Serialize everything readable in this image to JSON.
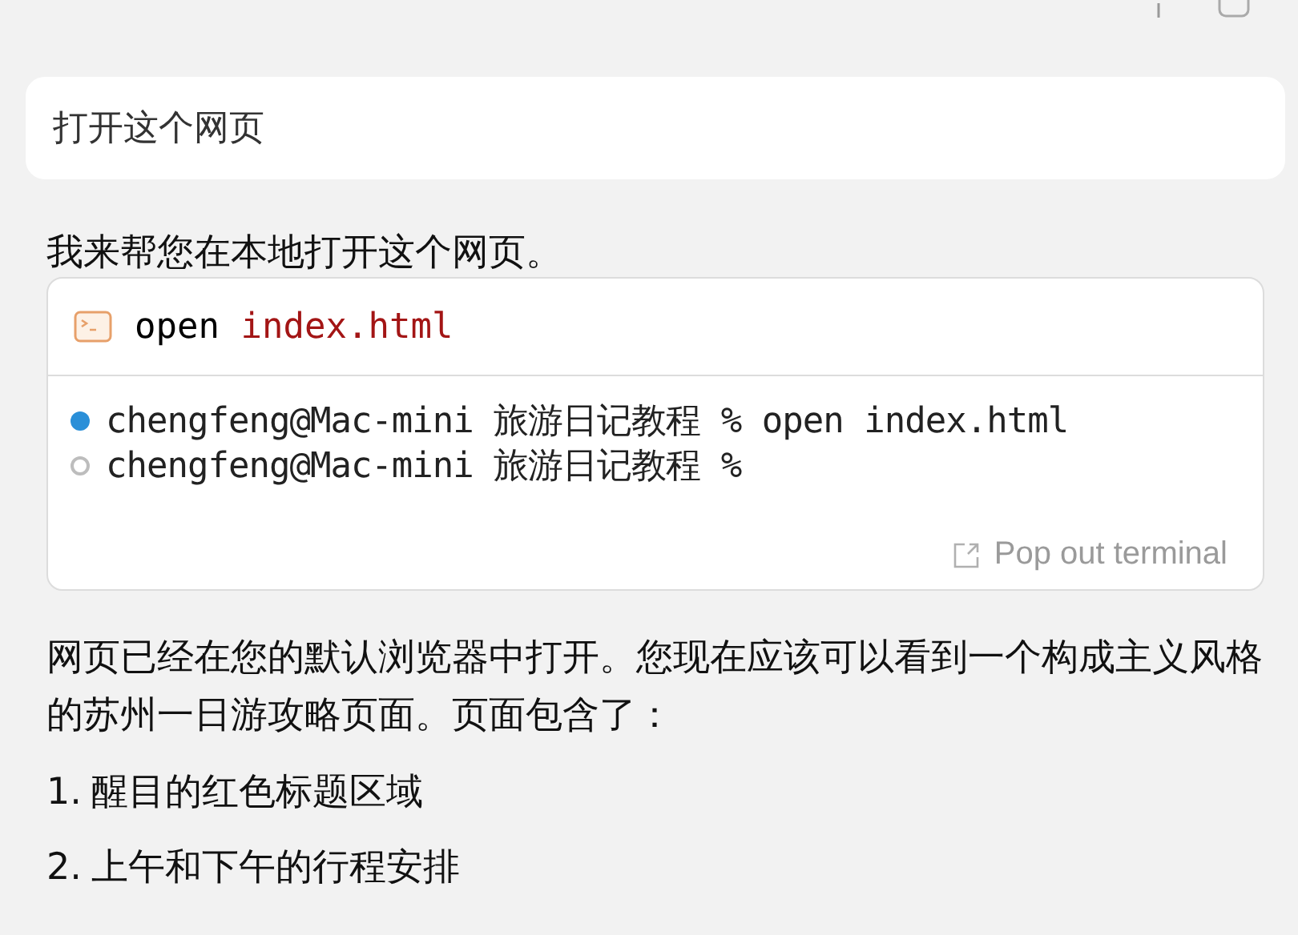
{
  "user_message": {
    "text": "打开这个网页"
  },
  "reply_intro": "我来帮您在本地打开这个网页。",
  "terminal": {
    "command": "open",
    "argument": "index.html",
    "lines": [
      {
        "kind": "active",
        "text": "chengfeng@Mac-mini 旅游日记教程 % open index.html"
      },
      {
        "kind": "idle",
        "text": "chengfeng@Mac-mini 旅游日记教程 %"
      }
    ],
    "pop_out": "Pop out terminal"
  },
  "reply_paragraph": "网页已经在您的默认浏览器中打开。您现在应该可以看到一个构成主义风格的苏州一日游攻略页面。页面包含了：",
  "list_items": [
    {
      "number": "1.",
      "text": "醒目的红色标题区域"
    },
    {
      "number": "2.",
      "text": "上午和下午的行程安排"
    }
  ]
}
